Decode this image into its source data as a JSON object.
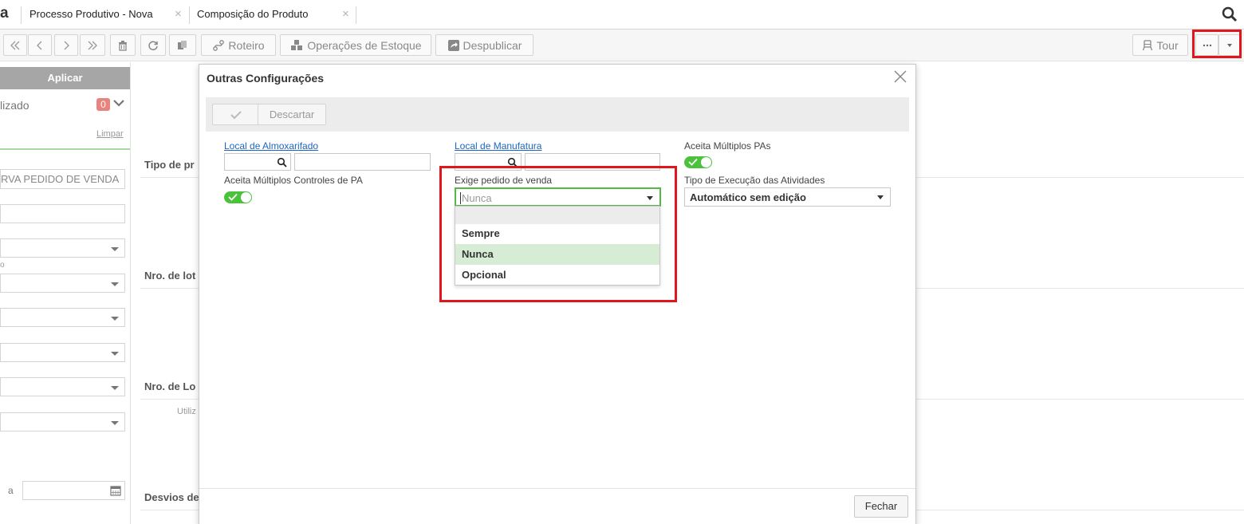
{
  "tabs": {
    "logo_char": "a",
    "items": [
      {
        "label": "Processo Produtivo - Nova"
      },
      {
        "label": "Composição do Produto"
      }
    ]
  },
  "toolbar": {
    "roteiro_label": "Roteiro",
    "operacoes_label": "Operações de Estoque",
    "despublicar_label": "Despublicar",
    "tour_label": "Tour"
  },
  "left_panel": {
    "apply_label": "Aplicar",
    "filter_text": "lizado",
    "filter_count": "0",
    "clear_label": "Limpar",
    "reserva_text": "RVA PEDIDO DE VENDA",
    "small_label": "o",
    "range_sep": "a"
  },
  "background": {
    "labels": [
      "Tipo de pr",
      "Nro. de lot",
      "Nro. de Lo",
      "Desvios de"
    ],
    "utiliz_text": "Utiliz"
  },
  "modal": {
    "title": "Outras Configurações",
    "discard_label": "Descartar",
    "fields": {
      "local_almoxarifado": "Local de Almoxarifado",
      "local_manufatura": "Local de Manufatura",
      "aceita_multiplos_pas": "Aceita Múltiplos PAs",
      "aceita_multiplos_controles": "Aceita Múltiplos Controles de PA",
      "exige_pedido": "Exige pedido de venda",
      "tipo_execucao": "Tipo de Execução das Atividades"
    },
    "exige_pedido_value": "Nunca",
    "tipo_execucao_value": "Automático sem edição",
    "dropdown_options": [
      "Sempre",
      "Nunca",
      "Opcional"
    ],
    "dropdown_selected": "Nunca",
    "close_label": "Fechar"
  },
  "colors": {
    "accent_green": "#4cc13c",
    "highlight_red": "#e0161c",
    "link_blue": "#1a66c2"
  }
}
